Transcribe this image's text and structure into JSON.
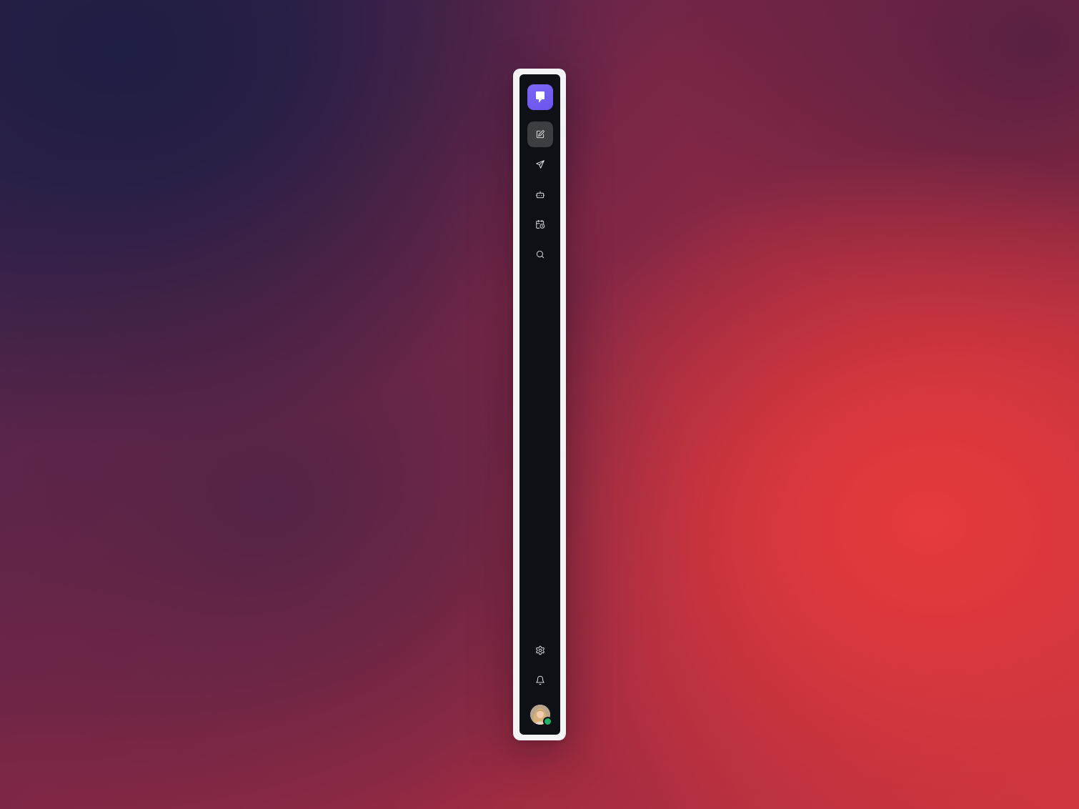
{
  "app": {
    "logo_icon": "chat-bubble-logo-icon",
    "accent_color": "#6b58ef"
  },
  "sidebar": {
    "top_items": [
      {
        "name": "compose",
        "icon": "edit-icon",
        "active": true
      },
      {
        "name": "send",
        "icon": "send-icon",
        "active": false
      },
      {
        "name": "bot",
        "icon": "bot-icon",
        "active": false
      },
      {
        "name": "schedule",
        "icon": "calendar-clock-icon",
        "active": false
      },
      {
        "name": "search",
        "icon": "search-icon",
        "active": false
      }
    ],
    "bottom_items": [
      {
        "name": "settings",
        "icon": "gear-icon"
      },
      {
        "name": "notifications",
        "icon": "bell-icon"
      }
    ],
    "user": {
      "status": "online",
      "status_color": "#20b26b"
    }
  }
}
